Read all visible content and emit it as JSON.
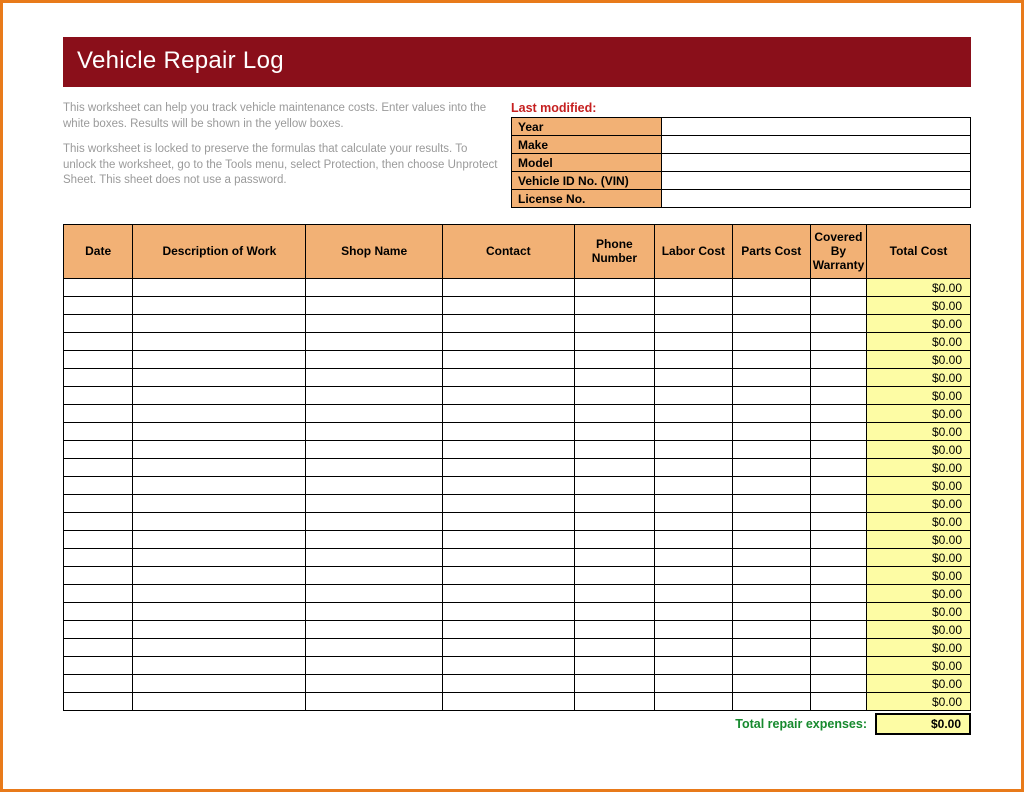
{
  "title": "Vehicle Repair Log",
  "intro": {
    "p1": "This worksheet can help you track vehicle maintenance costs. Enter values into the white boxes. Results will be shown in the yellow boxes.",
    "p2": "This worksheet is locked to preserve the formulas that calculate your results. To unlock the worksheet, go to the Tools menu, select Protection, then choose Unprotect Sheet. This sheet does not use a password."
  },
  "meta": {
    "last_modified_label": "Last modified:",
    "rows": [
      {
        "label": "Year",
        "value": ""
      },
      {
        "label": "Make",
        "value": ""
      },
      {
        "label": "Model",
        "value": ""
      },
      {
        "label": "Vehicle ID No. (VIN)",
        "value": ""
      },
      {
        "label": "License No.",
        "value": ""
      }
    ]
  },
  "columns": {
    "date": "Date",
    "desc": "Description of Work",
    "shop": "Shop Name",
    "contact": "Contact",
    "phone": "Phone Number",
    "labor": "Labor Cost",
    "parts": "Parts Cost",
    "warranty": "Covered By Warranty",
    "total": "Total Cost"
  },
  "rows": [
    {
      "date": "",
      "desc": "",
      "shop": "",
      "contact": "",
      "phone": "",
      "labor": "",
      "parts": "",
      "warranty": "",
      "total": "$0.00"
    },
    {
      "date": "",
      "desc": "",
      "shop": "",
      "contact": "",
      "phone": "",
      "labor": "",
      "parts": "",
      "warranty": "",
      "total": "$0.00"
    },
    {
      "date": "",
      "desc": "",
      "shop": "",
      "contact": "",
      "phone": "",
      "labor": "",
      "parts": "",
      "warranty": "",
      "total": "$0.00"
    },
    {
      "date": "",
      "desc": "",
      "shop": "",
      "contact": "",
      "phone": "",
      "labor": "",
      "parts": "",
      "warranty": "",
      "total": "$0.00"
    },
    {
      "date": "",
      "desc": "",
      "shop": "",
      "contact": "",
      "phone": "",
      "labor": "",
      "parts": "",
      "warranty": "",
      "total": "$0.00"
    },
    {
      "date": "",
      "desc": "",
      "shop": "",
      "contact": "",
      "phone": "",
      "labor": "",
      "parts": "",
      "warranty": "",
      "total": "$0.00"
    },
    {
      "date": "",
      "desc": "",
      "shop": "",
      "contact": "",
      "phone": "",
      "labor": "",
      "parts": "",
      "warranty": "",
      "total": "$0.00"
    },
    {
      "date": "",
      "desc": "",
      "shop": "",
      "contact": "",
      "phone": "",
      "labor": "",
      "parts": "",
      "warranty": "",
      "total": "$0.00"
    },
    {
      "date": "",
      "desc": "",
      "shop": "",
      "contact": "",
      "phone": "",
      "labor": "",
      "parts": "",
      "warranty": "",
      "total": "$0.00"
    },
    {
      "date": "",
      "desc": "",
      "shop": "",
      "contact": "",
      "phone": "",
      "labor": "",
      "parts": "",
      "warranty": "",
      "total": "$0.00"
    },
    {
      "date": "",
      "desc": "",
      "shop": "",
      "contact": "",
      "phone": "",
      "labor": "",
      "parts": "",
      "warranty": "",
      "total": "$0.00"
    },
    {
      "date": "",
      "desc": "",
      "shop": "",
      "contact": "",
      "phone": "",
      "labor": "",
      "parts": "",
      "warranty": "",
      "total": "$0.00"
    },
    {
      "date": "",
      "desc": "",
      "shop": "",
      "contact": "",
      "phone": "",
      "labor": "",
      "parts": "",
      "warranty": "",
      "total": "$0.00"
    },
    {
      "date": "",
      "desc": "",
      "shop": "",
      "contact": "",
      "phone": "",
      "labor": "",
      "parts": "",
      "warranty": "",
      "total": "$0.00"
    },
    {
      "date": "",
      "desc": "",
      "shop": "",
      "contact": "",
      "phone": "",
      "labor": "",
      "parts": "",
      "warranty": "",
      "total": "$0.00"
    },
    {
      "date": "",
      "desc": "",
      "shop": "",
      "contact": "",
      "phone": "",
      "labor": "",
      "parts": "",
      "warranty": "",
      "total": "$0.00"
    },
    {
      "date": "",
      "desc": "",
      "shop": "",
      "contact": "",
      "phone": "",
      "labor": "",
      "parts": "",
      "warranty": "",
      "total": "$0.00"
    },
    {
      "date": "",
      "desc": "",
      "shop": "",
      "contact": "",
      "phone": "",
      "labor": "",
      "parts": "",
      "warranty": "",
      "total": "$0.00"
    },
    {
      "date": "",
      "desc": "",
      "shop": "",
      "contact": "",
      "phone": "",
      "labor": "",
      "parts": "",
      "warranty": "",
      "total": "$0.00"
    },
    {
      "date": "",
      "desc": "",
      "shop": "",
      "contact": "",
      "phone": "",
      "labor": "",
      "parts": "",
      "warranty": "",
      "total": "$0.00"
    },
    {
      "date": "",
      "desc": "",
      "shop": "",
      "contact": "",
      "phone": "",
      "labor": "",
      "parts": "",
      "warranty": "",
      "total": "$0.00"
    },
    {
      "date": "",
      "desc": "",
      "shop": "",
      "contact": "",
      "phone": "",
      "labor": "",
      "parts": "",
      "warranty": "",
      "total": "$0.00"
    },
    {
      "date": "",
      "desc": "",
      "shop": "",
      "contact": "",
      "phone": "",
      "labor": "",
      "parts": "",
      "warranty": "",
      "total": "$0.00"
    },
    {
      "date": "",
      "desc": "",
      "shop": "",
      "contact": "",
      "phone": "",
      "labor": "",
      "parts": "",
      "warranty": "",
      "total": "$0.00"
    }
  ],
  "summary": {
    "label": "Total repair expenses:",
    "value": "$0.00"
  }
}
